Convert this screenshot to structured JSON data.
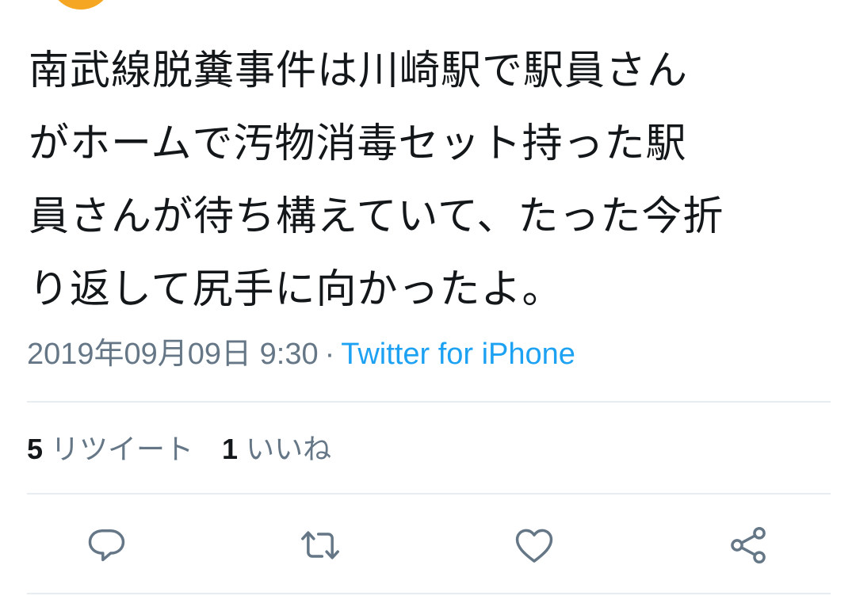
{
  "tweet": {
    "text": "南武線脱糞事件は川崎駅で駅員さん\nがホームで汚物消毒セット持った駅\n員さんが待ち構えていて、たった今折\nり返して尻手に向かったよ。",
    "timestamp": "2019年09月09日 9:30",
    "separator": "·",
    "source": "Twitter for iPhone"
  },
  "stats": {
    "retweets_count": "5",
    "retweets_label": "リツイート",
    "likes_count": "1",
    "likes_label": "いいね"
  },
  "actions": [
    {
      "name": "reply",
      "icon": "speech-bubble-icon"
    },
    {
      "name": "retweet",
      "icon": "retweet-arrows-icon"
    },
    {
      "name": "like",
      "icon": "heart-icon"
    },
    {
      "name": "share",
      "icon": "share-nodes-icon"
    }
  ],
  "colors": {
    "text": "#14171a",
    "secondary": "#657786",
    "link": "#1da1f2",
    "divider": "#e6ecf0",
    "avatar": "#f5a623"
  }
}
